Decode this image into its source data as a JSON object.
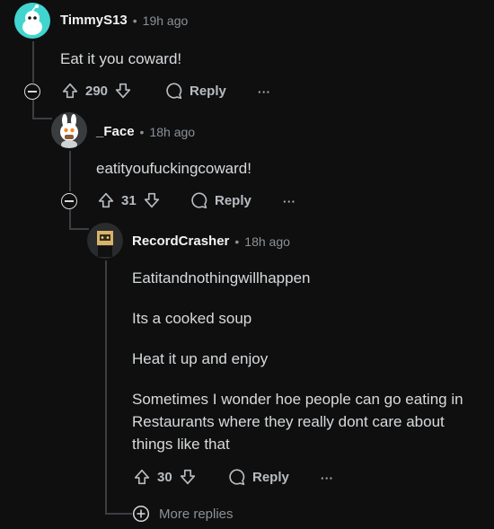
{
  "comments": [
    {
      "author": "TimmyS13",
      "time": "19h ago",
      "separator": "•",
      "body": [
        "Eat it you coward!"
      ],
      "score": "290",
      "reply_label": "Reply",
      "more_label": "···"
    },
    {
      "author": "_Face",
      "time": "18h ago",
      "separator": "•",
      "body": [
        "eatityoufuckingcoward!"
      ],
      "score": "31",
      "reply_label": "Reply",
      "more_label": "···"
    },
    {
      "author": "RecordCrasher",
      "time": "18h ago",
      "separator": "•",
      "body": [
        "Eatitandnothingwillhappen",
        "Its a cooked soup",
        "Heat it up and enjoy",
        "Sometimes I wonder hoe people can go eating in Restaurants where they really dont care about things like that"
      ],
      "score": "30",
      "reply_label": "Reply",
      "more_label": "···"
    }
  ],
  "more_replies_label": "More replies",
  "colors": {
    "background": "#0f0f10",
    "avatar1": "#42d5d0",
    "thread_line": "#3b3f43"
  }
}
